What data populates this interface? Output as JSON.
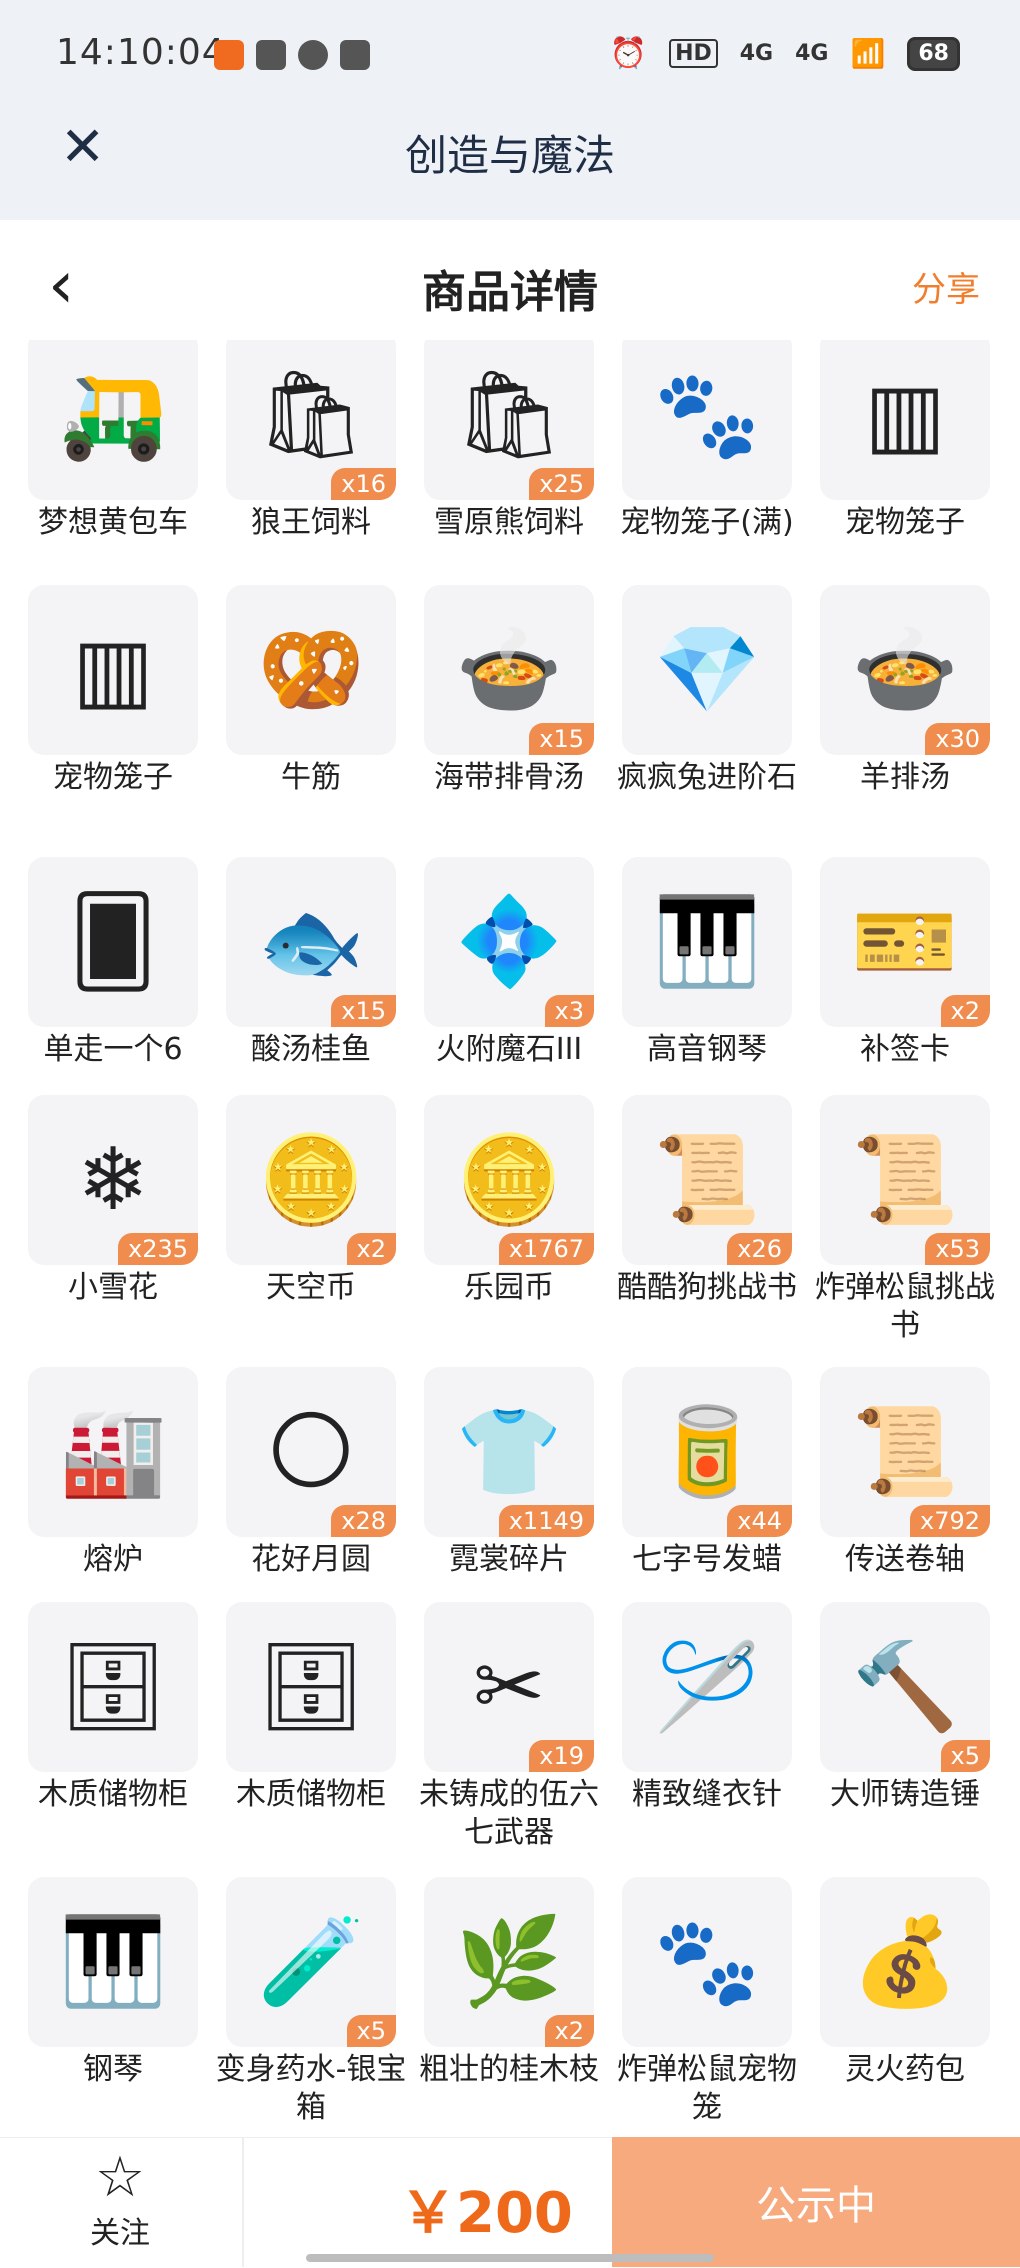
{
  "status": {
    "time": "14:10:04",
    "battery": "68",
    "icons": [
      "app-badge-icon",
      "mail-icon",
      "leaf-icon",
      "chat-icon",
      "alarm-icon",
      "hd-icon",
      "signal-4g-icon",
      "signal-4g-icon",
      "wifi-icon",
      "battery-icon"
    ],
    "hd_label": "HD",
    "net1": "4G",
    "net2": "4G"
  },
  "header": {
    "app_title": "创造与魔法",
    "page_title": "商品详情",
    "share_label": "分享"
  },
  "items": [
    {
      "name": "梦想黄包车",
      "icon": "rickshaw-icon",
      "qty": "",
      "glyph": "🛺"
    },
    {
      "name": "狼王饲料",
      "icon": "wolf-food-bag-icon",
      "qty": "x16",
      "glyph": "🛍"
    },
    {
      "name": "雪原熊饲料",
      "icon": "bear-food-bag-icon",
      "qty": "x25",
      "glyph": "🛍"
    },
    {
      "name": "宠物笼子(满)",
      "icon": "pet-cage-full-icon",
      "qty": "",
      "glyph": "🐾"
    },
    {
      "name": "宠物笼子",
      "icon": "pet-cage-icon",
      "qty": "",
      "glyph": "▥"
    },
    {
      "name": "宠物笼子",
      "icon": "pet-cage-icon",
      "qty": "",
      "glyph": "▥"
    },
    {
      "name": "牛筋",
      "icon": "beef-tendon-icon",
      "qty": "",
      "glyph": "🥨"
    },
    {
      "name": "海带排骨汤",
      "icon": "soup-bowl-icon",
      "qty": "x15",
      "glyph": "🍲"
    },
    {
      "name": "疯疯兔进阶石",
      "icon": "gem-stone-icon",
      "qty": "",
      "glyph": "💎"
    },
    {
      "name": "羊排汤",
      "icon": "stew-icon",
      "qty": "x30",
      "glyph": "🍲"
    },
    {
      "name": "单走一个6",
      "icon": "card-icon",
      "qty": "",
      "glyph": "🂠"
    },
    {
      "name": "酸汤桂鱼",
      "icon": "fish-dish-icon",
      "qty": "x15",
      "glyph": "🐟"
    },
    {
      "name": "火附魔石III",
      "icon": "fire-crystal-icon",
      "qty": "x3",
      "glyph": "💠"
    },
    {
      "name": "高音钢琴",
      "icon": "grand-piano-icon",
      "qty": "",
      "glyph": "🎹"
    },
    {
      "name": "补签卡",
      "icon": "ticket-icon",
      "qty": "x2",
      "glyph": "🎫"
    },
    {
      "name": "小雪花",
      "icon": "snowflake-icon",
      "qty": "x235",
      "glyph": "❄"
    },
    {
      "name": "天空币",
      "icon": "sky-coin-icon",
      "qty": "x2",
      "glyph": "🪙"
    },
    {
      "name": "乐园币",
      "icon": "park-coin-icon",
      "qty": "x1767",
      "glyph": "🪙"
    },
    {
      "name": "酷酷狗挑战书",
      "icon": "wanted-poster-icon",
      "qty": "x26",
      "glyph": "📜"
    },
    {
      "name": "炸弹松鼠挑战书",
      "icon": "wanted-poster-icon",
      "qty": "x53",
      "glyph": "📜"
    },
    {
      "name": "熔炉",
      "icon": "furnace-icon",
      "qty": "",
      "glyph": "🏭"
    },
    {
      "name": "花好月圆",
      "icon": "moon-rabbit-icon",
      "qty": "x28",
      "glyph": "🌕"
    },
    {
      "name": "霓裳碎片",
      "icon": "shirt-shard-icon",
      "qty": "x1149",
      "glyph": "👕"
    },
    {
      "name": "七字号发蜡",
      "icon": "hair-wax-icon",
      "qty": "x44",
      "glyph": "🥫"
    },
    {
      "name": "传送卷轴",
      "icon": "scroll-icon",
      "qty": "x792",
      "glyph": "📜"
    },
    {
      "name": "木质储物柜",
      "icon": "wooden-cabinet-icon",
      "qty": "",
      "glyph": "🗄"
    },
    {
      "name": "木质储物柜",
      "icon": "wooden-cabinet-icon",
      "qty": "",
      "glyph": "🗄"
    },
    {
      "name": "未铸成的伍六七武器",
      "icon": "scissors-icon",
      "qty": "x19",
      "glyph": "✂"
    },
    {
      "name": "精致缝衣针",
      "icon": "needle-icon",
      "qty": "",
      "glyph": "🪡"
    },
    {
      "name": "大师铸造锤",
      "icon": "hammer-icon",
      "qty": "x5",
      "glyph": "🔨"
    },
    {
      "name": "钢琴",
      "icon": "piano-icon",
      "qty": "",
      "glyph": "🎹"
    },
    {
      "name": "变身药水-银宝箱",
      "icon": "potion-icon",
      "qty": "x5",
      "glyph": "🧪"
    },
    {
      "name": "粗壮的桂木枝",
      "icon": "branch-icon",
      "qty": "x2",
      "glyph": "🌿"
    },
    {
      "name": "炸弹松鼠宠物笼",
      "icon": "pet-cage-blue-icon",
      "qty": "",
      "glyph": "🐾"
    },
    {
      "name": "灵火药包",
      "icon": "herb-bag-icon",
      "qty": "",
      "glyph": "💰"
    }
  ],
  "bottom": {
    "follow_label": "关注",
    "price": "￥200",
    "cta_label": "公示中"
  },
  "colors": {
    "accent": "#f07e2c",
    "price": "#ee6a1a",
    "cta_bg": "#f7aa7d",
    "header_bg": "#eef2f6"
  }
}
